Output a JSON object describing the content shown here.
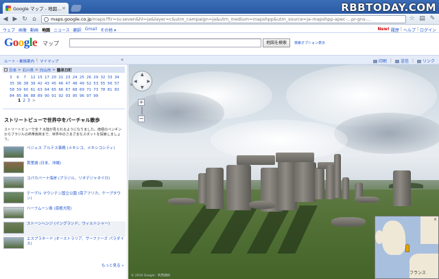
{
  "browser": {
    "tab_title": "Google マップ - 地図...",
    "tab_close": "×",
    "url_host": "maps.google.co.jp",
    "url_rest": "/maps?ftr=sv.seven&hl=ja&layer=c&utm_campaign=ja&utm_medium=mapshpp&utm_source=ja-mapshpp-apec-...pr-gns-..."
  },
  "watermark": "RBBTODAY.COM",
  "google_bar": {
    "left": [
      "ウェブ",
      "画像",
      "動画",
      "地図",
      "ニュース",
      "翻訳",
      "Gmail",
      "その他 ▾"
    ],
    "current": "地図",
    "right": [
      "New!",
      "履歴",
      "ヘルプ",
      "ログイン"
    ]
  },
  "header": {
    "logo_letters": [
      "G",
      "o",
      "o",
      "g",
      "l",
      "e"
    ],
    "logo_sub": "マップ",
    "search_button": "地図を検索",
    "search_options": "検索オプション表示"
  },
  "subbar": {
    "left_links": [
      "ルート・乗換案内",
      "マイマップ"
    ],
    "collapse": "«",
    "right_links": [
      "印刷",
      "送信",
      "リンク"
    ]
  },
  "panel": {
    "breadcrumb": [
      "日本",
      "石川県",
      "白山市",
      "鶴来日町"
    ],
    "breadcrumb_toggle": "−",
    "numbers": [
      "3",
      "6",
      "7",
      "12",
      "15",
      "17",
      "20",
      "21",
      "23",
      "24",
      "25",
      "26",
      "29",
      "32",
      "33",
      "34",
      "35",
      "36",
      "38",
      "39",
      "42",
      "43",
      "45",
      "46",
      "47",
      "48",
      "49",
      "52",
      "53",
      "55",
      "56",
      "57",
      "58",
      "59",
      "60",
      "61",
      "63",
      "64",
      "65",
      "66",
      "67",
      "68",
      "69",
      "71",
      "73",
      "78",
      "81",
      "83",
      "84",
      "85",
      "86",
      "88",
      "89",
      "90",
      "91",
      "92",
      "93",
      "95",
      "96",
      "97",
      "99"
    ],
    "pager": {
      "current": "1",
      "pages": [
        "2",
        "3"
      ],
      "next": ">"
    },
    "title": "ストリートビューで世界中をバーチャル散歩",
    "description": "ストリートビューで全 7 大陸が見られるようになりました。南極のペンギンからブラジルの熱帯雨林まで、世界中のさまざまなスポットを探索しましょう。",
    "places": [
      {
        "label": "ペジェス アルテス事務 (メキシコ、メキシコシティ)",
        "thumb": "#7d9db6"
      },
      {
        "label": "首里城 (日本、沖縄)",
        "thumb": "#8a6a4a"
      },
      {
        "label": "コパカバーナ海岸 (ブラジル、リオデジャネイロ)",
        "thumb": "#a4b6c4"
      },
      {
        "label": "テーブル マウンテン国立公園 (南アフリカ、ケープタウン)",
        "thumb": "#6f8e6c"
      },
      {
        "label": "ハーフムーン島 (南極大陸)",
        "thumb": "#c6d0d8"
      },
      {
        "label": "ストーンヘンジ (イングランド、ウィルトシャー)",
        "thumb": "#6f7f5a"
      },
      {
        "label": "エスプラネード (オーストラリア、サーファーズ パラダイス)",
        "thumb": "#9fb2c0"
      }
    ],
    "selected_index": 5,
    "more": "もっと見る »"
  },
  "view": {
    "copyright": "© 2010 Google · 利用規約",
    "minimap_label": "フランス",
    "minimap_close": "×"
  }
}
